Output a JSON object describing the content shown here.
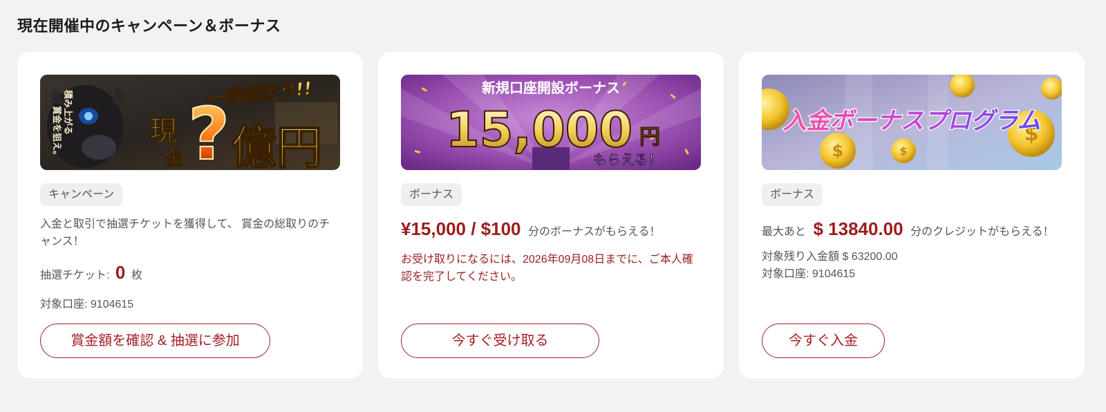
{
  "page": {
    "title": "現在開催中のキャンペーン＆ボーナス"
  },
  "cards": [
    {
      "banner": {
        "text_left_small": "積み上がる賞金を狙え。",
        "text_top": "一撃総取り!!",
        "text_cash": "現金",
        "text_q": "?",
        "text_main": "億円"
      },
      "tag": "キャンペーン",
      "description": "入金と取引で抽選チケットを獲得して、 賞金の総取りのチャンス！",
      "ticket_label": "抽選チケット:",
      "ticket_count": "0",
      "ticket_unit": "枚",
      "account": "対象口座: 9104615",
      "button": "賞金額を確認 & 抽選に参加"
    },
    {
      "banner": {
        "text_top": "新規口座開設ボーナス",
        "text_main": "15,000",
        "text_yen": "円",
        "text_sub": "もらえる！"
      },
      "tag": "ボーナス",
      "amount": "¥15,000 / $100",
      "amount_suffix": "分のボーナスがもらえる！",
      "notice": "お受け取りになるには、2026年09月08日までに、ご本人確認を完了してください。",
      "button": "今すぐ受け取る"
    },
    {
      "banner": {
        "text_main": "入金ボーナスプログラム",
        "coin_symbol": "$"
      },
      "tag": "ボーナス",
      "prefix": "最大あと",
      "amount": "$ 13840.00",
      "amount_suffix": "分のクレジットがもらえる！",
      "remaining": "対象残り入金額 $ 63200.00",
      "account": "対象口座: 9104615",
      "button": "今すぐ入金"
    }
  ],
  "colors": {
    "accent": "#a31f24",
    "amount": "#9b1c1c",
    "background": "#f2f2f2"
  }
}
